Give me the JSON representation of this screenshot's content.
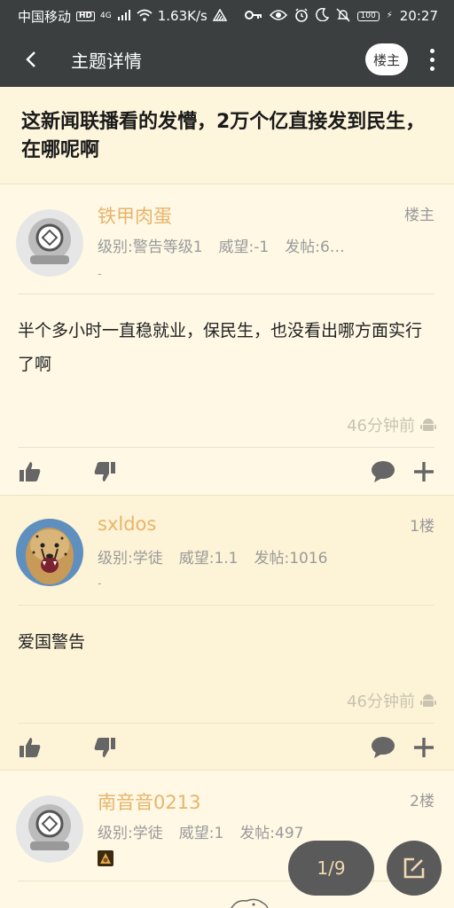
{
  "status_bar": {
    "carrier": "中国移动",
    "hd": "HD",
    "network": "4G",
    "speed": "1.63K/s",
    "battery": "100",
    "time": "20:27"
  },
  "app_bar": {
    "title": "主题详情",
    "op_only_label": "楼主"
  },
  "topic": {
    "title": "这新闻联播看的发懵，2万个亿直接发到民生，在哪呢啊"
  },
  "posts": [
    {
      "username": "铁甲肉蛋",
      "floor": "楼主",
      "level": "级别:警告等级1",
      "prestige": "威望:-1",
      "post_count": "发帖:6…",
      "signature": "-",
      "content": "半个多小时一直稳就业，保民生，也没看出哪方面实行了啊",
      "time": "46分钟前"
    },
    {
      "username": "sxldos",
      "floor": "1楼",
      "level": "级别:学徒",
      "prestige": "威望:1.1",
      "post_count": "发帖:1016",
      "signature": "-",
      "content": "爱国警告",
      "time": "46分钟前"
    },
    {
      "username": "南音音0213",
      "floor": "2楼",
      "level": "级别:学徒",
      "prestige": "威望:1",
      "post_count": "发帖:497"
    }
  ],
  "pager": {
    "label": "1/9"
  },
  "colors": {
    "app_bar": "#3b3f3f",
    "username": "#e8b46a",
    "background": "#fdf6e0",
    "fab": "#5a5a5a"
  }
}
